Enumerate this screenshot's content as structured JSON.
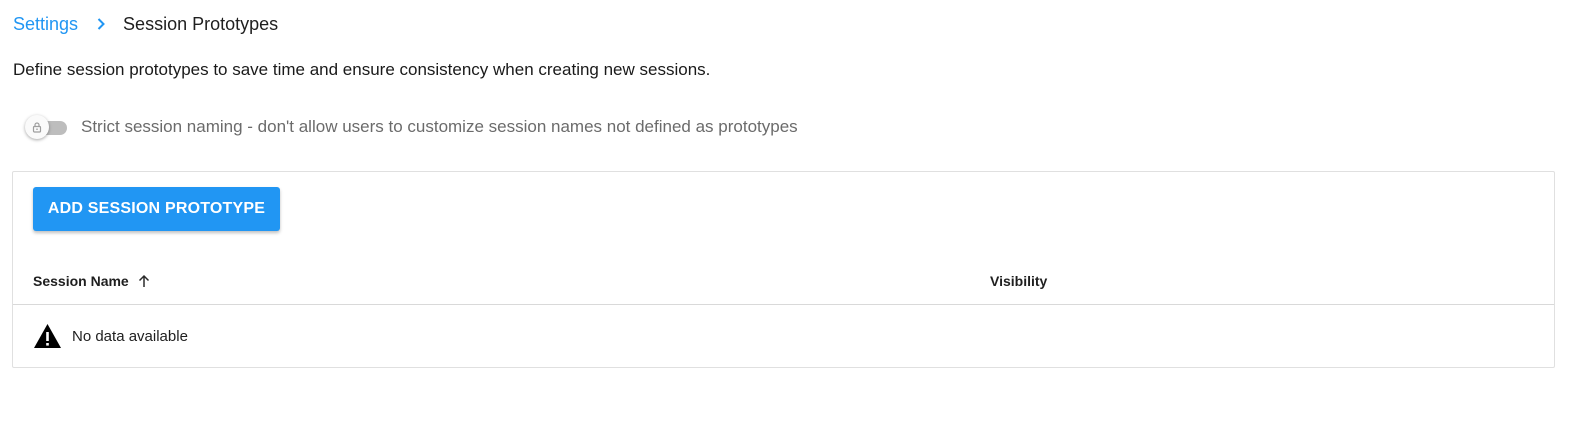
{
  "breadcrumb": {
    "parent": "Settings",
    "separator_icon": "chevron-right-icon",
    "current": "Session Prototypes"
  },
  "description": "Define session prototypes to save time and ensure consistency when creating new sessions.",
  "strict_naming": {
    "label": "Strict session naming - don't allow users to customize session names not defined as prototypes",
    "enabled": false,
    "locked": true,
    "icon": "lock-icon"
  },
  "toolbar": {
    "add_label": "ADD SESSION PROTOTYPE"
  },
  "table": {
    "columns": [
      {
        "label": "Session Name",
        "sort": "ascending",
        "sort_icon": "arrow-up-icon"
      },
      {
        "label": "Visibility"
      }
    ],
    "rows": [],
    "empty": {
      "icon": "warning-icon",
      "text": "No data available"
    }
  },
  "colors": {
    "accent": "#2196f3",
    "switch_track": "#bdbdbd",
    "border": "#e0e0e0"
  }
}
